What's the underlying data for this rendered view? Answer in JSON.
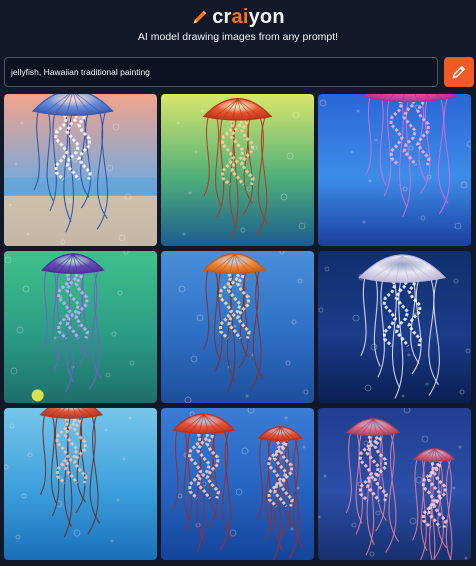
{
  "app": {
    "logo_prefix": "cr",
    "logo_accent": "ai",
    "logo_suffix": "yon",
    "logo_icon": "pencil-icon",
    "subtitle": "AI model drawing images from any prompt!"
  },
  "prompt": {
    "value": "jellyfish, Hawaiian traditional painting",
    "draw_icon": "pencil-icon"
  },
  "colors": {
    "background": "#111827",
    "accent": "#f15a24",
    "logo_accent": "#f97316"
  },
  "results": [
    {
      "subject": "blue jellyfish over sunset beach"
    },
    {
      "subject": "orange jellyfish on green background"
    },
    {
      "subject": "pink jellyfish on blue background"
    },
    {
      "subject": "purple jellyfish on green background"
    },
    {
      "subject": "orange jellyfish on blue background"
    },
    {
      "subject": "white jellyfish on dark blue background"
    },
    {
      "subject": "orange jellyfish on light blue water"
    },
    {
      "subject": "two jellyfish on blue background"
    },
    {
      "subject": "two jellyfish on navy background"
    }
  ]
}
